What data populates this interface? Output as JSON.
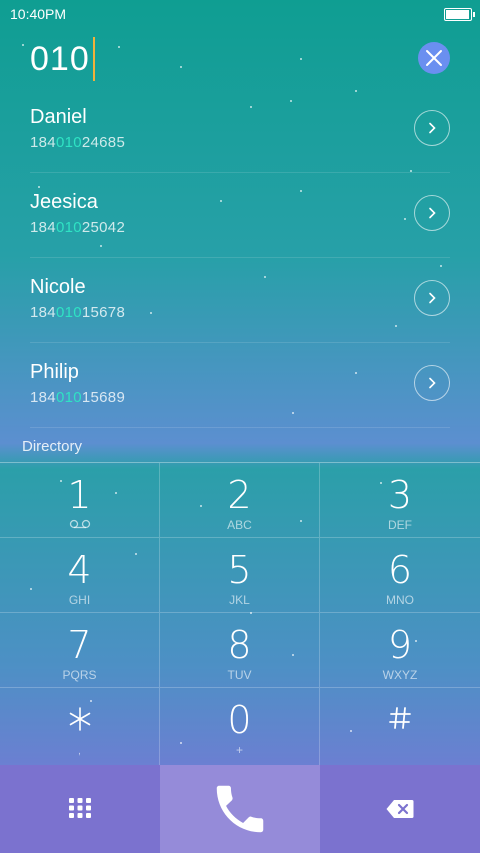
{
  "status": {
    "time": "10:40PM",
    "battery_level": 0.95
  },
  "dialer": {
    "entered": "010"
  },
  "contacts": [
    {
      "name": "Daniel",
      "phone_pre": "184",
      "phone_match": "010",
      "phone_post": "24685"
    },
    {
      "name": "Jeesica",
      "phone_pre": "184",
      "phone_match": "010",
      "phone_post": "25042"
    },
    {
      "name": "Nicole",
      "phone_pre": "184",
      "phone_match": "010",
      "phone_post": "15678"
    },
    {
      "name": "Philip",
      "phone_pre": "184",
      "phone_match": "010",
      "phone_post": "15689"
    }
  ],
  "section": {
    "directory": "Directory"
  },
  "keys": [
    {
      "digit": "1",
      "letters": ""
    },
    {
      "digit": "2",
      "letters": "ABC"
    },
    {
      "digit": "3",
      "letters": "DEF"
    },
    {
      "digit": "4",
      "letters": "GHI"
    },
    {
      "digit": "5",
      "letters": "JKL"
    },
    {
      "digit": "6",
      "letters": "MNO"
    },
    {
      "digit": "7",
      "letters": "PQRS"
    },
    {
      "digit": "8",
      "letters": "TUV"
    },
    {
      "digit": "9",
      "letters": "WXYZ"
    },
    {
      "digit": "",
      "letters": ""
    },
    {
      "digit": "0",
      "letters": "+"
    },
    {
      "digit": "",
      "letters": ""
    }
  ],
  "icons": {
    "clear": "close-icon",
    "row_action": "chevron-right-icon",
    "voicemail": "voicemail-icon",
    "star": "asterisk-icon",
    "hash": "hash-icon",
    "keypad_toggle": "dialpad-icon",
    "call": "phone-icon",
    "delete": "backspace-icon"
  },
  "colors": {
    "highlight": "#2fe3c4",
    "caret": "#f2b13a",
    "clear_button": "#6a8ff0",
    "call_button": "#958bd9"
  }
}
